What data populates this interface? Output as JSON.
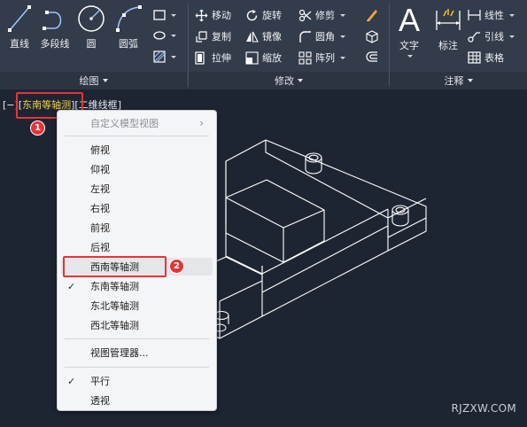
{
  "ribbon": {
    "draw_panel": {
      "title": "绘图",
      "tools": [
        {
          "label": "直线",
          "icon": "line-icon"
        },
        {
          "label": "多段线",
          "icon": "polyline-icon"
        },
        {
          "label": "圆",
          "icon": "circle-icon"
        },
        {
          "label": "圆弧",
          "icon": "arc-icon"
        }
      ],
      "small_icons": [
        "rectangle-icon",
        "ellipse-icon",
        "hatch-icon"
      ]
    },
    "modify_panel": {
      "title": "修改",
      "tools": [
        {
          "label": "移动",
          "icon": "move-icon"
        },
        {
          "label": "旋转",
          "icon": "rotate-icon"
        },
        {
          "label": "修剪",
          "icon": "trim-icon"
        },
        {
          "label": "复制",
          "icon": "copy-icon"
        },
        {
          "label": "镜像",
          "icon": "mirror-icon"
        },
        {
          "label": "圆角",
          "icon": "fillet-icon"
        },
        {
          "label": "拉伸",
          "icon": "stretch-icon"
        },
        {
          "label": "缩放",
          "icon": "scale-icon"
        },
        {
          "label": "阵列",
          "icon": "array-icon"
        }
      ],
      "extra_icons": [
        "erase-icon",
        "explode-icon",
        "offset-icon"
      ]
    },
    "annotation_panel": {
      "title": "注释",
      "big_tools": [
        {
          "label": "文字",
          "icon": "text-icon"
        },
        {
          "label": "标注",
          "icon": "dimension-icon"
        }
      ],
      "small_tools": [
        {
          "label": "线性",
          "icon": "linear-dim-icon"
        },
        {
          "label": "引线",
          "icon": "leader-icon"
        },
        {
          "label": "表格",
          "icon": "table-icon"
        }
      ]
    }
  },
  "viewport": {
    "label_prefix": "[−][",
    "view_name": "东南等轴测",
    "label_middle": "][",
    "visual_style": "二维线框",
    "label_suffix": "]"
  },
  "badges": {
    "first": "1",
    "second": "2"
  },
  "context_menu": {
    "custom_views": "自定义模型视图",
    "items": [
      "俯视",
      "仰视",
      "左视",
      "右视",
      "前视",
      "后视",
      "西南等轴测",
      "东南等轴测",
      "东北等轴测",
      "西北等轴测"
    ],
    "checked_view": "东南等轴测",
    "highlighted_view": "西南等轴测",
    "view_manager": "视图管理器...",
    "projection": [
      "平行",
      "透视"
    ],
    "checked_projection": "平行"
  },
  "watermark": "RJZXW.COM",
  "colors": {
    "accent_red": "#e53535",
    "active_view_yellow": "#f0d24a",
    "background": "#1e2532"
  }
}
